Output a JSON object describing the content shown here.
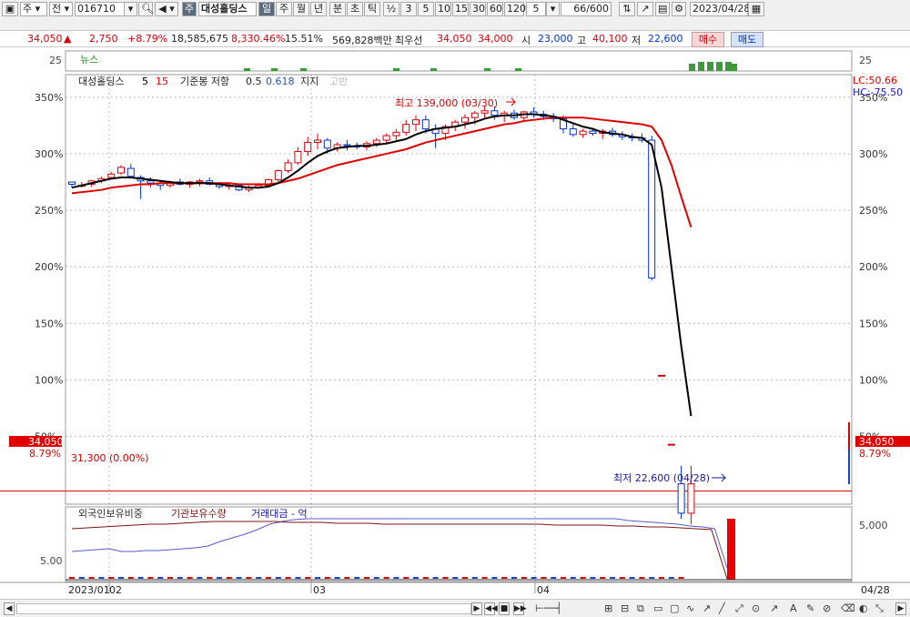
{
  "toolbar": {
    "type_sel": "주",
    "market_sel": "전",
    "code": "016710",
    "name": "대성홀딩스",
    "period_btns": [
      "일",
      "주",
      "월",
      "년"
    ],
    "active_period": "일",
    "intraday_btns": [
      "분",
      "초",
      "틱"
    ],
    "interval_btns": [
      "½",
      "3",
      "5",
      "10",
      "15",
      "30",
      "60",
      "120"
    ],
    "interval_input": "5",
    "count": "66",
    "count_total": "/600",
    "date": "2023/04/28"
  },
  "quote": {
    "price": "34,050",
    "change": "2,750",
    "change_pct": "+8.79%",
    "volume": "18,585,675",
    "volume_pct": "8,330.46%",
    "turnover": "15.51%",
    "amount": "569,828백만",
    "best_label": "최우선",
    "ask": "34,050",
    "bid": "34,000",
    "open_label": "시",
    "open": "23,000",
    "high_label": "고",
    "high": "40,100",
    "low_label": "저",
    "low": "22,600",
    "buy_label": "매수",
    "sell_label": "매도"
  },
  "news": {
    "label": "뉴스",
    "value": "25",
    "right_value": "25"
  },
  "legend": {
    "stock": "대성홀딩스",
    "ma_fast": "5",
    "ma_slow": "15",
    "indicator": "기준봉 저항",
    "ind_a": "0.5",
    "ind_b": "0.618",
    "support": "지지",
    "extra": "고반"
  },
  "annotations": {
    "high": "최고 139,000 (03/30)",
    "low": "최저 22,600 (04/28)",
    "baseline": "31,300 (0.00%)",
    "lc": "LC:50.66",
    "hc": "HC:-75.50",
    "price_tag": "34,050",
    "pct_tag": "8.79%"
  },
  "axes": {
    "y_left": [
      "350%",
      "300%",
      "250%",
      "200%",
      "150%",
      "100%",
      "50%"
    ],
    "y_right": [
      "350%",
      "300%",
      "250%",
      "200%",
      "150%",
      "100%",
      "50%"
    ],
    "x_labels": [
      "2023/01",
      "02",
      "03",
      "04"
    ],
    "x_right": "04/28"
  },
  "subpanel": {
    "legend": [
      "외국인보유비중",
      "기관보유수량",
      "거래대금 - 억"
    ],
    "left_value": "5.00",
    "right_value": "5,000"
  },
  "colors": {
    "up": "#d8000c",
    "down": "#0033cc",
    "ma_slow": "#e00000",
    "ma_fast": "#000000"
  },
  "chart_data": {
    "type": "candlestick",
    "y_unit": "% vs 31,300 base",
    "ylim": [
      -10,
      370
    ],
    "candles": [
      [
        275,
        275,
        270,
        273
      ],
      [
        272,
        275,
        270,
        272
      ],
      [
        273,
        277,
        271,
        276
      ],
      [
        276,
        280,
        274,
        278
      ],
      [
        279,
        284,
        277,
        282
      ],
      [
        283,
        290,
        281,
        288
      ],
      [
        287,
        291,
        278,
        280
      ],
      [
        279,
        281,
        260,
        276
      ],
      [
        276,
        279,
        270,
        274
      ],
      [
        274,
        276,
        268,
        272
      ],
      [
        272,
        276,
        270,
        275
      ],
      [
        275,
        278,
        272,
        273
      ],
      [
        273,
        276,
        270,
        275
      ],
      [
        275,
        278,
        271,
        276
      ],
      [
        276,
        279,
        272,
        273
      ],
      [
        273,
        275,
        269,
        271
      ],
      [
        271,
        274,
        268,
        272
      ],
      [
        272,
        273,
        267,
        268
      ],
      [
        268,
        272,
        266,
        270
      ],
      [
        270,
        274,
        269,
        272
      ],
      [
        272,
        278,
        270,
        277
      ],
      [
        277,
        286,
        275,
        285
      ],
      [
        285,
        295,
        283,
        292
      ],
      [
        292,
        306,
        290,
        302
      ],
      [
        302,
        315,
        298,
        310
      ],
      [
        310,
        318,
        304,
        312
      ],
      [
        312,
        314,
        300,
        305
      ],
      [
        305,
        310,
        302,
        308
      ],
      [
        308,
        312,
        303,
        307
      ],
      [
        307,
        310,
        304,
        306
      ],
      [
        306,
        311,
        303,
        309
      ],
      [
        309,
        314,
        306,
        312
      ],
      [
        312,
        318,
        309,
        316
      ],
      [
        316,
        322,
        312,
        319
      ],
      [
        319,
        330,
        316,
        326
      ],
      [
        326,
        334,
        320,
        330
      ],
      [
        330,
        334,
        318,
        322
      ],
      [
        322,
        326,
        305,
        318
      ],
      [
        318,
        326,
        312,
        324
      ],
      [
        324,
        330,
        320,
        328
      ],
      [
        328,
        335,
        322,
        332
      ],
      [
        332,
        338,
        326,
        336
      ],
      [
        336,
        342,
        332,
        338
      ],
      [
        338,
        342,
        330,
        334
      ],
      [
        334,
        338,
        328,
        336
      ],
      [
        336,
        339,
        330,
        332
      ],
      [
        332,
        338,
        328,
        337
      ],
      [
        337,
        341,
        332,
        335
      ],
      [
        335,
        338,
        330,
        333
      ],
      [
        333,
        336,
        328,
        331
      ],
      [
        331,
        334,
        318,
        322
      ],
      [
        322,
        326,
        315,
        317
      ],
      [
        317,
        322,
        314,
        320
      ],
      [
        320,
        323,
        316,
        318
      ],
      [
        318,
        322,
        313,
        320
      ],
      [
        320,
        323,
        315,
        317
      ],
      [
        317,
        320,
        312,
        315
      ],
      [
        315,
        318,
        311,
        314
      ],
      [
        314,
        318,
        310,
        312
      ],
      [
        312,
        316,
        188,
        190
      ],
      [
        104,
        104,
        104,
        104
      ],
      [
        43,
        43,
        43,
        43
      ],
      [
        8,
        24,
        -23,
        -18
      ],
      [
        -18,
        24,
        -28,
        8
      ]
    ],
    "ma_fast": [
      270,
      272,
      274,
      276,
      278,
      279,
      279,
      278,
      277,
      276,
      275,
      274,
      274,
      274,
      274,
      273,
      272,
      271,
      270,
      270,
      271,
      274,
      279,
      285,
      292,
      298,
      302,
      305,
      306,
      307,
      307,
      308,
      309,
      311,
      313,
      317,
      320,
      322,
      323,
      324,
      326,
      328,
      331,
      333,
      334,
      334,
      335,
      335,
      334,
      333,
      330,
      327,
      324,
      322,
      319,
      318,
      317,
      315,
      314,
      308,
      270,
      200,
      130,
      68
    ],
    "ma_slow": [
      265,
      266,
      267,
      268,
      270,
      271,
      272,
      273,
      273,
      274,
      274,
      274,
      274,
      274,
      274,
      274,
      274,
      273,
      273,
      273,
      273,
      274,
      276,
      278,
      281,
      284,
      287,
      290,
      292,
      294,
      296,
      298,
      300,
      302,
      304,
      307,
      310,
      312,
      314,
      316,
      318,
      320,
      322,
      324,
      326,
      327,
      329,
      330,
      331,
      332,
      332,
      332,
      332,
      331,
      330,
      329,
      328,
      327,
      326,
      324,
      312,
      290,
      262,
      235
    ],
    "volume_right": 5000
  }
}
